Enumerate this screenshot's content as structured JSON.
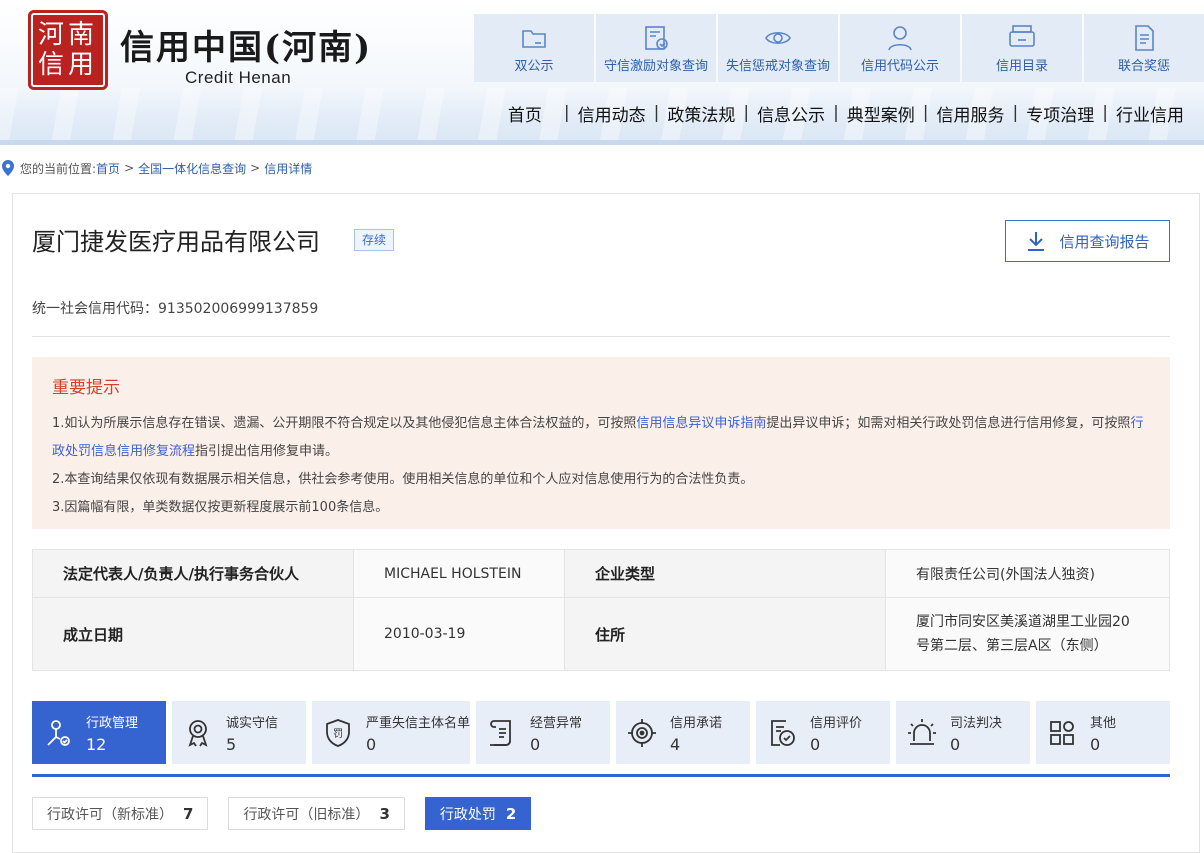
{
  "header": {
    "seal_text": "河南信用",
    "title": "信用中国(河南)",
    "subtitle": "Credit Henan",
    "quick_links": [
      {
        "label": "双公示",
        "icon": "folder-icon"
      },
      {
        "label": "守信激励对象查询",
        "icon": "shield-certificate-icon"
      },
      {
        "label": "失信惩戒对象查询",
        "icon": "eye-icon"
      },
      {
        "label": "信用代码公示",
        "icon": "user-icon"
      },
      {
        "label": "信用目录",
        "icon": "printer-icon"
      },
      {
        "label": "联合奖惩",
        "icon": "document-icon"
      }
    ],
    "nav": [
      "首页",
      "信用动态",
      "政策法规",
      "信息公示",
      "典型案例",
      "信用服务",
      "专项治理",
      "行业信用"
    ]
  },
  "breadcrumb": {
    "prefix": "您的当前位置:",
    "items": [
      "首页",
      "全国一体化信息查询",
      "信用详情"
    ]
  },
  "company": {
    "name": "厦门捷发医疗用品有限公司",
    "status": "存续",
    "report_button": "信用查询报告",
    "code_label": "统一社会信用代码：",
    "code": "913502006999137859"
  },
  "notice": {
    "title": "重要提示",
    "line1_a": "1.如认为所展示信息存在错误、遗漏、公开期限不符合规定以及其他侵犯信息主体合法权益的，可按照",
    "line1_link1": "信用信息异议申诉指南",
    "line1_b": "提出异议申诉；如需对相关行政处罚信息进行信用修复，可按照",
    "line1_link2": "行政处罚信息信用修复流程",
    "line1_c": "指引提出信用修复申请。",
    "line2": "2.本查询结果仅依现有数据展示相关信息，供社会参考使用。使用相关信息的单位和个人应对信息使用行为的合法性负责。",
    "line3": "3.因篇幅有限，单类数据仅按更新程度展示前100条信息。"
  },
  "info": {
    "legal_rep_label": "法定代表人/负责人/执行事务合伙人",
    "legal_rep": "MICHAEL HOLSTEIN",
    "type_label": "企业类型",
    "type": "有限责任公司(外国法人独资)",
    "date_label": "成立日期",
    "date": "2010-03-19",
    "address_label": "住所",
    "address": "厦门市同安区美溪道湖里工业园20号第二层、第三层A区（东侧）"
  },
  "tabs": [
    {
      "label": "行政管理",
      "count": "12",
      "icon": "admin-icon",
      "active": true
    },
    {
      "label": "诚实守信",
      "count": "5",
      "icon": "medal-icon"
    },
    {
      "label": "严重失信主体名单",
      "count": "0",
      "icon": "penalty-shield-icon"
    },
    {
      "label": "经营异常",
      "count": "0",
      "icon": "scroll-icon"
    },
    {
      "label": "信用承诺",
      "count": "4",
      "icon": "target-icon"
    },
    {
      "label": "信用评价",
      "count": "0",
      "icon": "evaluation-icon"
    },
    {
      "label": "司法判决",
      "count": "0",
      "icon": "alarm-icon"
    },
    {
      "label": "其他",
      "count": "0",
      "icon": "grid-icon"
    }
  ],
  "subtabs": [
    {
      "label": "行政许可（新标准）",
      "count": "7"
    },
    {
      "label": "行政许可（旧标准）",
      "count": "3"
    },
    {
      "label": "行政处罚",
      "count": "2",
      "active": true
    }
  ],
  "colors": {
    "primary": "#3563cf",
    "notice_bg": "#fbefea",
    "notice_title": "#d6402c",
    "seal": "#b9221f"
  }
}
